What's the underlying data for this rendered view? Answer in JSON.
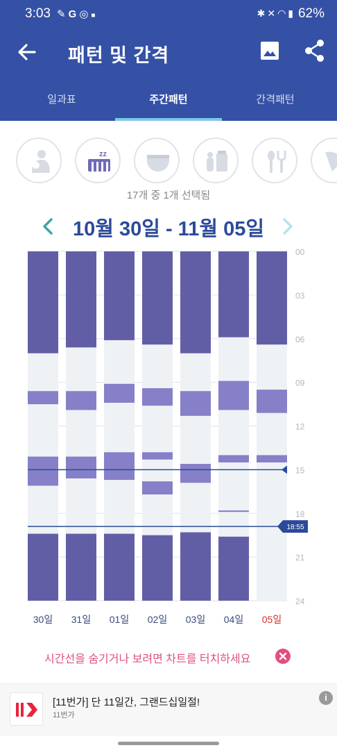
{
  "status_bar": {
    "time": "3:03",
    "left_icons": [
      "notification-icon",
      "g-icon",
      "instagram-icon",
      "dot-icon"
    ],
    "right_icons": [
      "bluetooth-icon",
      "mute-icon",
      "wifi-icon",
      "signal-icon"
    ],
    "battery": "62%"
  },
  "header": {
    "title": "패턴 및 간격",
    "bg_color": "#3551a5"
  },
  "tabs": [
    {
      "label": "일과표",
      "active": false
    },
    {
      "label": "주간패턴",
      "active": true
    },
    {
      "label": "간격패턴",
      "active": false
    }
  ],
  "categories": [
    {
      "icon": "nursing-icon",
      "selected": false
    },
    {
      "icon": "sleep-icon",
      "selected": true
    },
    {
      "icon": "diaper-icon",
      "selected": false
    },
    {
      "icon": "bottle-icon",
      "selected": false
    },
    {
      "icon": "feeding-utensils-icon",
      "selected": false
    },
    {
      "icon": "more-category-icon",
      "selected": false
    }
  ],
  "selection_count": "17개 중 1개 선택됨",
  "date_range": "10월 30일 - 11월 05일",
  "chart_data": {
    "type": "bar",
    "orientation": "vertical-timeline",
    "categories": [
      "30일",
      "31일",
      "01일",
      "02일",
      "03일",
      "04일",
      "05일"
    ],
    "today_category": "05일",
    "y_axis": {
      "range": [
        0,
        24
      ],
      "ticks": [
        "00",
        "03",
        "06",
        "09",
        "12",
        "15",
        "18",
        "21",
        "24"
      ],
      "inverted": true,
      "position": "right"
    },
    "series": [
      {
        "activity": "sleep",
        "color": "#6f6bb5",
        "values": [
          [
            [
              0,
              7.0
            ],
            [
              9.6,
              10.5
            ],
            [
              14.1,
              16.1
            ],
            [
              19.4,
              24
            ]
          ],
          [
            [
              0,
              6.6
            ],
            [
              9.6,
              10.9
            ],
            [
              14.1,
              15.6
            ],
            [
              19.4,
              24
            ]
          ],
          [
            [
              0,
              6.1
            ],
            [
              9.1,
              10.4
            ],
            [
              13.8,
              15.7
            ],
            [
              19.4,
              24
            ]
          ],
          [
            [
              0,
              6.4
            ],
            [
              9.4,
              10.6
            ],
            [
              13.8,
              14.3
            ],
            [
              15.8,
              16.7
            ],
            [
              19.5,
              24
            ]
          ],
          [
            [
              0,
              7.0
            ],
            [
              9.6,
              11.3
            ],
            [
              14.6,
              15.9
            ],
            [
              19.3,
              24
            ]
          ],
          [
            [
              0,
              5.9
            ],
            [
              8.9,
              10.9
            ],
            [
              14.0,
              14.5
            ],
            [
              17.8,
              17.9
            ],
            [
              19.6,
              24
            ]
          ],
          [
            [
              0,
              6.4
            ],
            [
              9.5,
              11.1
            ],
            [
              14.0,
              14.5
            ]
          ]
        ]
      }
    ],
    "reference_lines": [
      {
        "hour": 15.0,
        "label": ""
      },
      {
        "hour": 18.9,
        "label": "18:55"
      }
    ],
    "grid": true,
    "colors": {
      "active": "#6f6bb5",
      "background": "#eef2f5",
      "today_label": "#d22f2f",
      "line": "#2c4a9a"
    }
  },
  "hint": {
    "text": "시간선을 숨기거나 보려면 차트를 터치하세요"
  },
  "ad": {
    "logo": "11번가",
    "title": "[11번가] 단 11일간, 그랜드십일절!",
    "subtitle": "11번가"
  }
}
